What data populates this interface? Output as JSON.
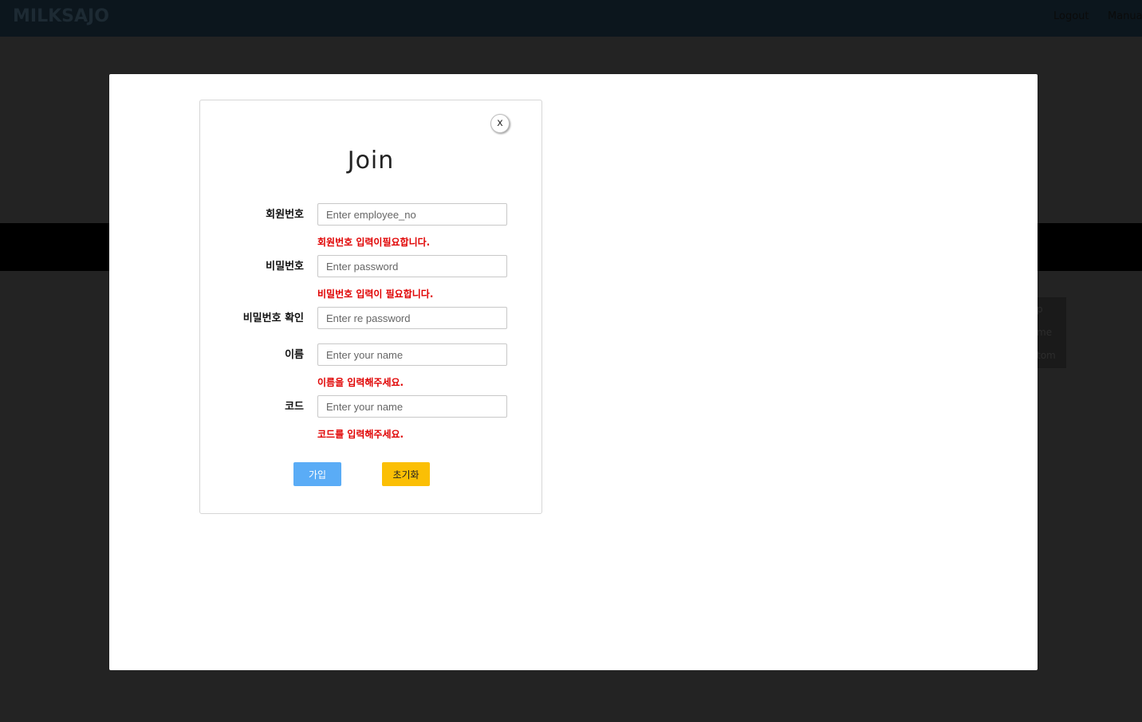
{
  "app": {
    "brand": "MILKSAJO",
    "nav": {
      "logout_label": "Logout",
      "manual_label": "Manual"
    }
  },
  "background": {
    "side_panel_items": [
      "p",
      "me",
      "tom"
    ]
  },
  "dialog": {
    "close_label": "x",
    "title": "Join",
    "fields": [
      {
        "label": "회원번호",
        "placeholder": "Enter employee_no",
        "value": "",
        "error": "회원번호 입력이필요합니다."
      },
      {
        "label": "비밀번호",
        "placeholder": "Enter password",
        "value": "",
        "error": "비밀번호 입력이 필요합니다."
      },
      {
        "label": "비밀번호 확인",
        "placeholder": "Enter re password",
        "value": "",
        "error": ""
      },
      {
        "label": "이름",
        "placeholder": "Enter your name",
        "value": "",
        "error": "이름을 입력해주세요."
      },
      {
        "label": "코드",
        "placeholder": "Enter your name",
        "value": "",
        "error": "코드를 입력해주세요."
      }
    ],
    "join_button_label": "가입",
    "reset_button_label": "초기화"
  },
  "colors": {
    "join_button": "#5aacf6",
    "reset_button": "#fbbf05",
    "error_text": "#e00000"
  }
}
